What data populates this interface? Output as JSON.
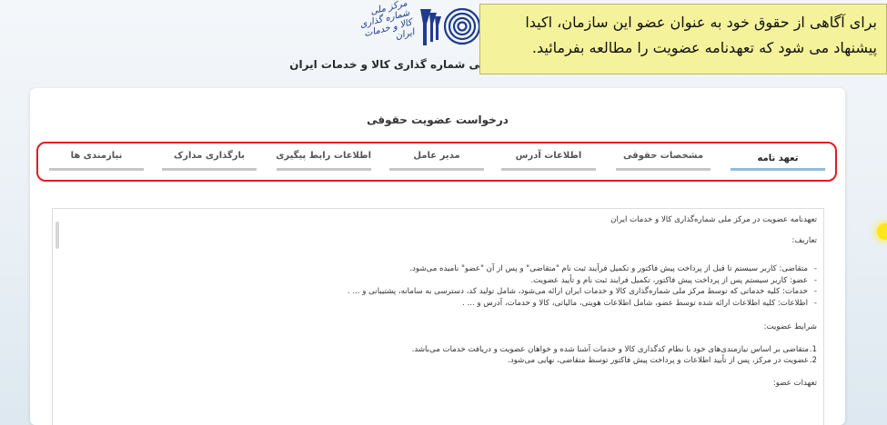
{
  "header": {
    "org_title": "ملی شماره گذاری کالا و خدمات ایران",
    "logo_script": "مرکز ملی شماره گذاری کالا و خدمات ایران"
  },
  "notice": {
    "line1": "برای آگاهی از حقوق خود به عنوان عضو این سازمان، اکیدا",
    "line2": "پیشنهاد می شود که تعهدنامه عضویت را مطالعه بفرمائید."
  },
  "page": {
    "title": "درخواست عضویت حقوقی"
  },
  "tabs": [
    {
      "label": "تعهد نامه",
      "active": true
    },
    {
      "label": "مشخصات حقوقی",
      "active": false
    },
    {
      "label": "اطلاعات آدرس",
      "active": false
    },
    {
      "label": "مدیر عامل",
      "active": false
    },
    {
      "label": "اطلاعات رابط پیگیری",
      "active": false
    },
    {
      "label": "بارگذاری مدارک",
      "active": false
    },
    {
      "label": "نیازمندی ها",
      "active": false
    }
  ],
  "document": {
    "title": "تعهدنامه عضویت در مرکز ملی شماره‌گذاری کالا و خدمات ایران",
    "definitions_heading": "تعاریف:",
    "definitions": [
      "متقاضی: کاربر سیستم تا قبل از پرداخت پیش فاکتور و تکمیل فرآیند ثبت نام \"متقاضی\" و پس از آن \"عضو\" نامیده می‌شود.",
      "عضو: کاربر سیستم پس از پرداخت پیش فاکتور، تکمیل فرایند ثبت نام و تأیید عضویت.",
      "خدمات: کلیه خدماتی که توسط مرکز ملی شماره‌گذاری کالا و خدمات ایران ارائه می‌شود، شامل تولید کد، دسترسی به سامانه، پشتیبانی و ... .",
      "اطلاعات: کلیه اطلاعات ارائه شده توسط عضو، شامل اطلاعات هویتی، مالیاتی، کالا و خدمات، آدرس و ... ."
    ],
    "conditions_heading": "شرایط عضویت:",
    "conditions": [
      {
        "num": "1.",
        "text": "متقاضی بر اساس نیازمندی‌های خود با نظام کدگذاری کالا و خدمات آشنا شده و خواهان عضویت و دریافت خدمات می‌باشد."
      },
      {
        "num": "2.",
        "text": "عضویت در مرکز، پس از تأیید اطلاعات و پرداخت پیش فاکتور توسط متقاضی، نهایی می‌شود."
      }
    ],
    "next_heading": "تعهدات عضو:"
  }
}
